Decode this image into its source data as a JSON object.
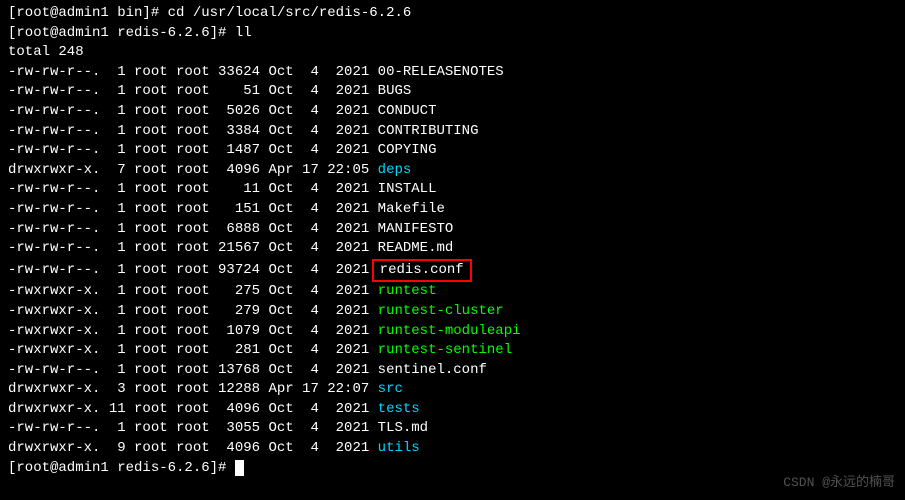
{
  "prompt1": "[root@admin1 bin]# ",
  "cmd1": "cd /usr/local/src/redis-6.2.6",
  "prompt2": "[root@admin1 redis-6.2.6]# ",
  "cmd2": "ll",
  "total": "total 248",
  "files": [
    {
      "perm": "-rw-rw-r--.",
      "links": " 1",
      "owner": "root",
      "group": "root",
      "size": "33624",
      "mon": "Oct",
      "day": " 4",
      "time": " 2021",
      "name": "00-RELEASENOTES",
      "cls": ""
    },
    {
      "perm": "-rw-rw-r--.",
      "links": " 1",
      "owner": "root",
      "group": "root",
      "size": "   51",
      "mon": "Oct",
      "day": " 4",
      "time": " 2021",
      "name": "BUGS",
      "cls": ""
    },
    {
      "perm": "-rw-rw-r--.",
      "links": " 1",
      "owner": "root",
      "group": "root",
      "size": " 5026",
      "mon": "Oct",
      "day": " 4",
      "time": " 2021",
      "name": "CONDUCT",
      "cls": ""
    },
    {
      "perm": "-rw-rw-r--.",
      "links": " 1",
      "owner": "root",
      "group": "root",
      "size": " 3384",
      "mon": "Oct",
      "day": " 4",
      "time": " 2021",
      "name": "CONTRIBUTING",
      "cls": ""
    },
    {
      "perm": "-rw-rw-r--.",
      "links": " 1",
      "owner": "root",
      "group": "root",
      "size": " 1487",
      "mon": "Oct",
      "day": " 4",
      "time": " 2021",
      "name": "COPYING",
      "cls": ""
    },
    {
      "perm": "drwxrwxr-x.",
      "links": " 7",
      "owner": "root",
      "group": "root",
      "size": " 4096",
      "mon": "Apr",
      "day": "17",
      "time": "22:05",
      "name": "deps",
      "cls": "cyan"
    },
    {
      "perm": "-rw-rw-r--.",
      "links": " 1",
      "owner": "root",
      "group": "root",
      "size": "   11",
      "mon": "Oct",
      "day": " 4",
      "time": " 2021",
      "name": "INSTALL",
      "cls": ""
    },
    {
      "perm": "-rw-rw-r--.",
      "links": " 1",
      "owner": "root",
      "group": "root",
      "size": "  151",
      "mon": "Oct",
      "day": " 4",
      "time": " 2021",
      "name": "Makefile",
      "cls": ""
    },
    {
      "perm": "-rw-rw-r--.",
      "links": " 1",
      "owner": "root",
      "group": "root",
      "size": " 6888",
      "mon": "Oct",
      "day": " 4",
      "time": " 2021",
      "name": "MANIFESTO",
      "cls": ""
    },
    {
      "perm": "-rw-rw-r--.",
      "links": " 1",
      "owner": "root",
      "group": "root",
      "size": "21567",
      "mon": "Oct",
      "day": " 4",
      "time": " 2021",
      "name": "README.md",
      "cls": ""
    },
    {
      "perm": "-rw-rw-r--.",
      "links": " 1",
      "owner": "root",
      "group": "root",
      "size": "93724",
      "mon": "Oct",
      "day": " 4",
      "time": " 2021",
      "name": "redis.conf",
      "cls": "",
      "box": true
    },
    {
      "perm": "-rwxrwxr-x.",
      "links": " 1",
      "owner": "root",
      "group": "root",
      "size": "  275",
      "mon": "Oct",
      "day": " 4",
      "time": " 2021",
      "name": "runtest",
      "cls": "green"
    },
    {
      "perm": "-rwxrwxr-x.",
      "links": " 1",
      "owner": "root",
      "group": "root",
      "size": "  279",
      "mon": "Oct",
      "day": " 4",
      "time": " 2021",
      "name": "runtest-cluster",
      "cls": "green"
    },
    {
      "perm": "-rwxrwxr-x.",
      "links": " 1",
      "owner": "root",
      "group": "root",
      "size": " 1079",
      "mon": "Oct",
      "day": " 4",
      "time": " 2021",
      "name": "runtest-moduleapi",
      "cls": "green"
    },
    {
      "perm": "-rwxrwxr-x.",
      "links": " 1",
      "owner": "root",
      "group": "root",
      "size": "  281",
      "mon": "Oct",
      "day": " 4",
      "time": " 2021",
      "name": "runtest-sentinel",
      "cls": "green"
    },
    {
      "perm": "-rw-rw-r--.",
      "links": " 1",
      "owner": "root",
      "group": "root",
      "size": "13768",
      "mon": "Oct",
      "day": " 4",
      "time": " 2021",
      "name": "sentinel.conf",
      "cls": ""
    },
    {
      "perm": "drwxrwxr-x.",
      "links": " 3",
      "owner": "root",
      "group": "root",
      "size": "12288",
      "mon": "Apr",
      "day": "17",
      "time": "22:07",
      "name": "src",
      "cls": "cyan"
    },
    {
      "perm": "drwxrwxr-x.",
      "links": "11",
      "owner": "root",
      "group": "root",
      "size": " 4096",
      "mon": "Oct",
      "day": " 4",
      "time": " 2021",
      "name": "tests",
      "cls": "cyan"
    },
    {
      "perm": "-rw-rw-r--.",
      "links": " 1",
      "owner": "root",
      "group": "root",
      "size": " 3055",
      "mon": "Oct",
      "day": " 4",
      "time": " 2021",
      "name": "TLS.md",
      "cls": ""
    },
    {
      "perm": "drwxrwxr-x.",
      "links": " 9",
      "owner": "root",
      "group": "root",
      "size": " 4096",
      "mon": "Oct",
      "day": " 4",
      "time": " 2021",
      "name": "utils",
      "cls": "cyan"
    }
  ],
  "prompt3": "[root@admin1 redis-6.2.6]# ",
  "watermark": "CSDN @永远的楠哥"
}
